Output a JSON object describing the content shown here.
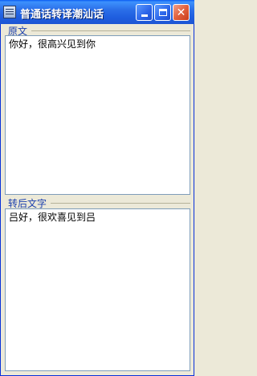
{
  "window": {
    "title": "普通话转译潮汕话",
    "icon": "app-icon",
    "controls": {
      "minimize": "minimize-icon",
      "maximize": "maximize-icon",
      "close": "close-icon",
      "close_glyph": "✕"
    }
  },
  "source": {
    "label": "原文",
    "text": "你好，很高兴见到你"
  },
  "result": {
    "label": "转后文字",
    "text": "吕好，很欢喜见到吕"
  },
  "colors": {
    "titlebar": "#2b6fe8",
    "label_text": "#1a3fae",
    "close_button": "#e2613d"
  }
}
